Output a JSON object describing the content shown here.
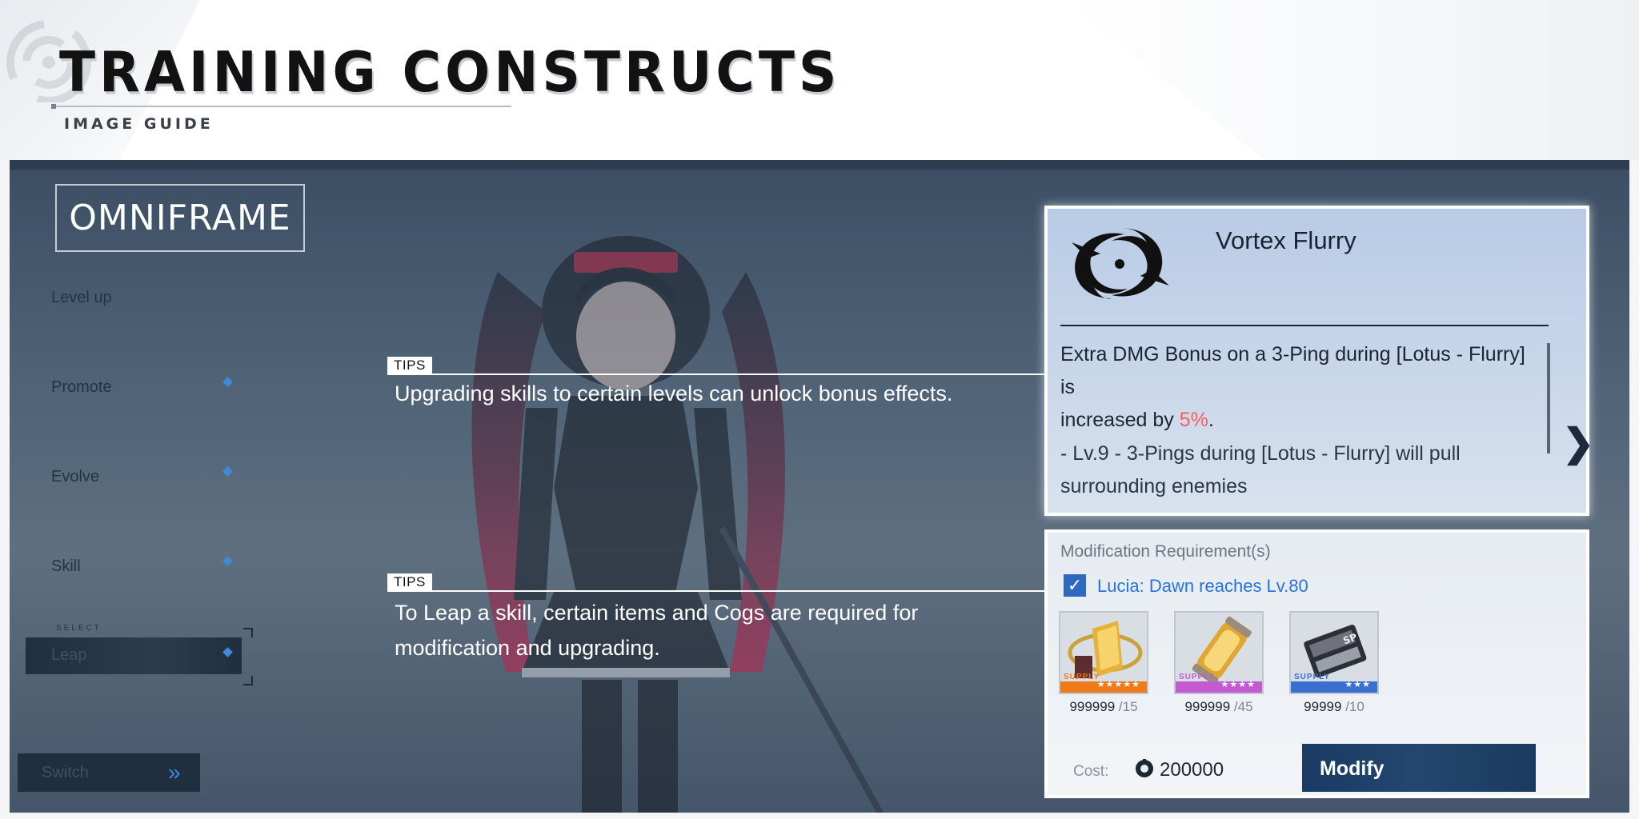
{
  "guide": {
    "title": "TRAINING CONSTRUCTS",
    "subtitle": "IMAGE GUIDE"
  },
  "sidebar": {
    "heading": "OMNIFRAME",
    "items": [
      {
        "label": "Level up"
      },
      {
        "label": "Promote"
      },
      {
        "label": "Evolve"
      },
      {
        "label": "Skill"
      }
    ],
    "select_label": "SELECT",
    "selected_item": "Leap",
    "switch_label": "Switch"
  },
  "tips": [
    {
      "badge": "TIPS",
      "text": "Upgrading skills to certain levels can unlock bonus effects."
    },
    {
      "badge": "TIPS",
      "text_line1": "To Leap a skill, certain items and Cogs are required for",
      "text_line2": "modification and upgrading."
    }
  ],
  "skill": {
    "name": "Vortex Flurry",
    "desc_line1": "Extra DMG Bonus on a 3-Ping during [Lotus - Flurry] is",
    "desc_line2_prefix": "increased by ",
    "desc_highlight": "5%",
    "desc_line2_suffix": ".",
    "desc2_line1": " - Lv.9 - 3-Pings during [Lotus - Flurry] will pull",
    "desc2_line2": "surrounding enemies",
    "icon": "swirl-skill-icon"
  },
  "modification": {
    "title": "Modification Requirement(s)",
    "requirement": "Lucia: Dawn reaches Lv.80",
    "requirement_checked": true,
    "items": [
      {
        "icon": "golden-crest-icon",
        "have": "999999",
        "need": "/15",
        "stripe_color": "#f07a1a",
        "stars": "★★★★★"
      },
      {
        "icon": "energy-capsule-icon",
        "have": "999999",
        "need": "/45",
        "stripe_color": "#c45ad0",
        "stars": "★★★★"
      },
      {
        "icon": "chip-module-icon",
        "have": "99999",
        "need": "/10",
        "stripe_color": "#3b6fcf",
        "stars": "★★★"
      }
    ],
    "supply_label": "SUPPLY",
    "cost_label": "Cost:",
    "cost_value": "200000",
    "modify_label": "Modify"
  }
}
